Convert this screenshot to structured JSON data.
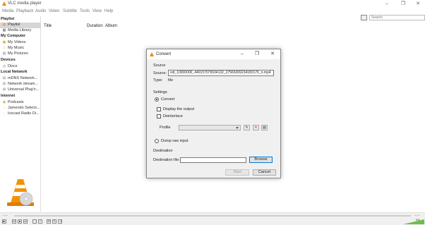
{
  "window": {
    "title": "VLC media player",
    "minimize": "–",
    "maximize": "❐",
    "close": "✕"
  },
  "menu": [
    "Media",
    "Playback",
    "Audio",
    "Video",
    "Subtitle",
    "Tools",
    "View",
    "Help"
  ],
  "search": {
    "placeholder": "Search"
  },
  "sidebar": {
    "playlist_heading": "Playlist",
    "playlist_items": [
      "Playlist",
      "Media Library"
    ],
    "mycomputer_heading": "My Computer",
    "mycomputer_items": [
      "My Videos",
      "My Music",
      "My Pictures"
    ],
    "devices_heading": "Devices",
    "devices_items": [
      "Discs"
    ],
    "lan_heading": "Local Network",
    "lan_items": [
      "mDNS Network...",
      "Network stream...",
      "Universal Plug'n..."
    ],
    "internet_heading": "Internet",
    "internet_items": [
      "Podcasts",
      "Jamendo Selecti...",
      "Icecast Radio Di..."
    ]
  },
  "playlist": {
    "columns": [
      "Title",
      "Duration",
      "Album"
    ]
  },
  "player": {
    "time_elapsed": "--:--",
    "time_total": "--:--",
    "volume": "0%"
  },
  "dialog": {
    "title": "Convert",
    "minimize": "–",
    "maximize": "❐",
    "close": "✕",
    "source_heading": "Source",
    "source_label": "Source:",
    "source_value": "vid_10000000_440157076534132_27566309234180176_n.mp4",
    "type_label": "Type:",
    "type_value": "file",
    "settings_heading": "Settings",
    "convert_option": "Convert",
    "display_output": "Display the output",
    "deinterlace": "Deinterlace",
    "profile_label": "Profile",
    "dump_raw": "Dump raw input",
    "destination_heading": "Destination",
    "destination_label": "Destination file:",
    "browse_button": "Browse",
    "start_button": "Start",
    "cancel_button": "Cancel"
  },
  "colors": {
    "accent": "#f08a00",
    "focus": "#0078d7",
    "volume": "#6abf4b"
  }
}
